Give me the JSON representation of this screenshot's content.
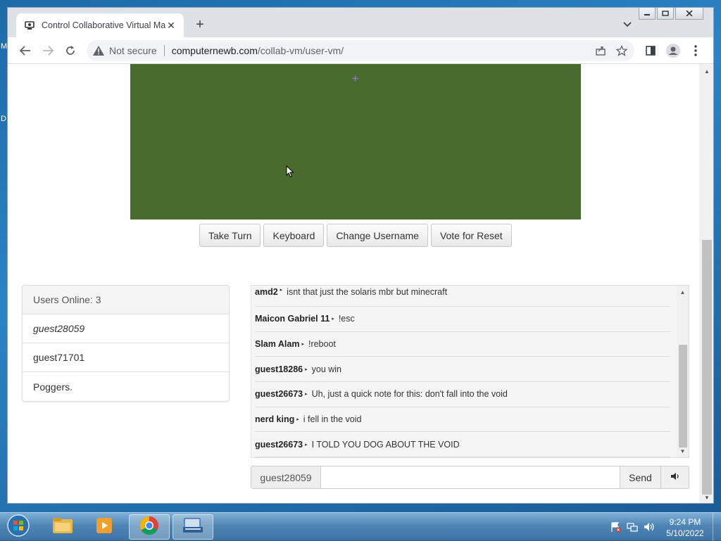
{
  "desktop": {
    "left_glyph_1": "M",
    "left_glyph_2": "D"
  },
  "browser": {
    "tab_title": "Control Collaborative Virtual Ma",
    "tab_close": "✕",
    "new_tab": "+",
    "not_secure": "Not secure",
    "url_host": "computernewb.com",
    "url_path": "/collab-vm/user-vm/"
  },
  "vm": {
    "crosshair": "+",
    "buttons": [
      "Take Turn",
      "Keyboard",
      "Change Username",
      "Vote for Reset"
    ]
  },
  "users": {
    "header": "Users Online: 3",
    "list": [
      "guest28059",
      "guest71701",
      "Poggers."
    ]
  },
  "chat": {
    "messages": [
      {
        "user": "amd2",
        "text": "isnt that just the solaris mbr but minecraft"
      },
      {
        "user": "Maicon Gabriel 11",
        "text": "!esc"
      },
      {
        "user": "Slam Alam",
        "text": "!reboot"
      },
      {
        "user": "guest18286",
        "text": "you win"
      },
      {
        "user": "guest26673",
        "text": "Uh, just a quick note for this: don't fall into the void"
      },
      {
        "user": "nerd king",
        "text": "i fell in the void"
      },
      {
        "user": "guest26673",
        "text": "I TOLD YOU DOG ABOUT THE VOID"
      }
    ],
    "arrow": "▸",
    "username": "guest28059",
    "input_value": "",
    "send_label": "Send"
  },
  "taskbar": {
    "time": "9:24 PM",
    "date": "5/10/2022"
  },
  "colors": {
    "vm_screen": "#4a6b2e",
    "taskbar": "#4f86b5",
    "desktop": "#2b83c4"
  }
}
